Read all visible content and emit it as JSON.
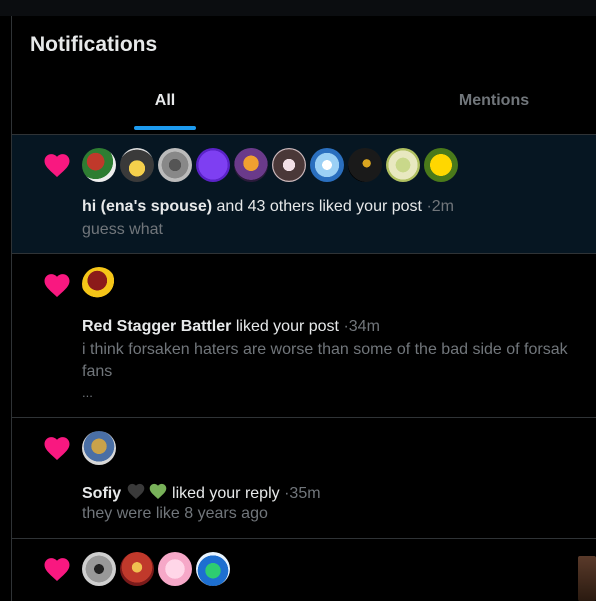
{
  "header": {
    "title": "Notifications"
  },
  "tabs": [
    {
      "label": "All",
      "active": true
    },
    {
      "label": "Mentions",
      "active": false
    }
  ],
  "notifications": [
    {
      "actor": "hi (ena's spouse)",
      "action": "and 43 others liked your post",
      "sep": "·",
      "time": "2m",
      "snippet": "guess what",
      "avatar_count": 10,
      "highlighted": true
    },
    {
      "actor": "Red Stagger Battler",
      "action": "liked your post",
      "sep": "·",
      "time": "34m",
      "snippet_line1": "i think forsaken haters are worse than some of the bad side of forsak",
      "snippet_line2": "fans",
      "snippet_line3": "..."
    },
    {
      "actor": "Sofiy",
      "action": "liked your reply",
      "sep": "·",
      "time": "35m",
      "snippet": "they were like 8 years ago"
    },
    {
      "avatar_count": 4
    }
  ],
  "colors": {
    "accent": "#1d9bf0",
    "heart": "#f91880",
    "muted": "#71767b",
    "text": "#e7e9ea",
    "highlight_bg": "#061622"
  },
  "icons": {
    "like": "heart-icon",
    "black_heart": "black-heart-icon",
    "green_heart": "green-heart-icon"
  }
}
